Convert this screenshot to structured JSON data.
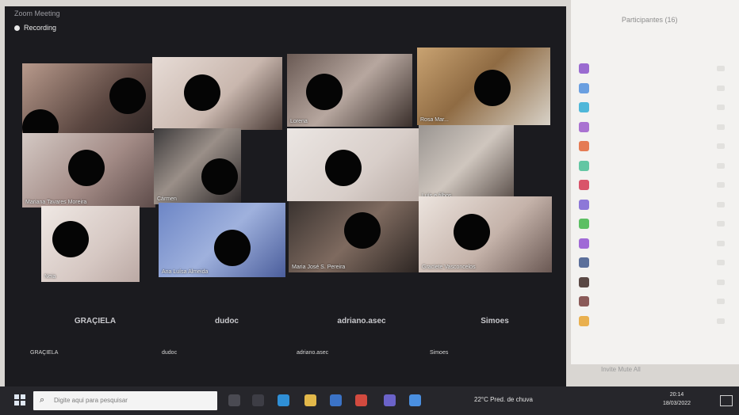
{
  "window": {
    "title": "Zoom Meeting",
    "recording_label": "Recording"
  },
  "video_tiles": [
    {
      "name": "",
      "bg": "linear-gradient(135deg,#b89a8c,#5a4640 60%,#2c2423)"
    },
    {
      "name": "",
      "bg": "linear-gradient(135deg,#e7dcd6,#c9b7ae 55%,#4a3b36)"
    },
    {
      "name": "Lorena",
      "bg": "linear-gradient(135deg,#6a5a54,#b7a79f 50%,#3a2f2b)"
    },
    {
      "name": "Rosa Mar...",
      "bg": "linear-gradient(135deg,#c9a372,#8f6b43 45%,#d8d2c8)"
    },
    {
      "name": "Mariana Tavares Moreira",
      "bg": "linear-gradient(135deg,#d4c9c4,#a38b86 55%,#5d4b49)"
    },
    {
      "name": "Cármen",
      "bg": "linear-gradient(135deg,#3c3a3b,#9a8f88 45%,#2a2627)"
    },
    {
      "name": "",
      "bg": "linear-gradient(135deg,#ebe6e3,#d8cec9 60%,#b9aca6)"
    },
    {
      "name": "Luís e filhos",
      "bg": "linear-gradient(135deg,#9a9591,#cfc6be 50%,#584d48)"
    },
    {
      "name": "Neia",
      "bg": "linear-gradient(135deg,#efe8e4,#d6c8c3 60%,#bba9a4)"
    },
    {
      "name": "Ana Luísa Almeida",
      "bg": "linear-gradient(135deg,#6d86c6,#9fb1dd 50%,#4b5e9c)"
    },
    {
      "name": "Maria José S. Pereira",
      "bg": "linear-gradient(135deg,#3a3330,#7e6a5f 50%,#2c2522)"
    },
    {
      "name": "Graciete Vasconcelos",
      "bg": "linear-gradient(135deg,#ece4de,#c5b3aa 55%,#6a5853)"
    }
  ],
  "audio_tiles": [
    {
      "display_name": "GRAÇIELA",
      "label": "GRAÇIELA"
    },
    {
      "display_name": "dudoc",
      "label": "dudoc"
    },
    {
      "display_name": "adriano.asec",
      "label": "adriano.asec"
    },
    {
      "display_name": "Simoes",
      "label": "Simoes"
    }
  ],
  "panel": {
    "title": "Participantes (16)",
    "participants": [
      {
        "color": "#9a6bd0",
        "name": ""
      },
      {
        "color": "#6a9fe0",
        "name": ""
      },
      {
        "color": "#4fb7d9",
        "name": ""
      },
      {
        "color": "#a972d1",
        "name": ""
      },
      {
        "color": "#e57b54",
        "name": ""
      },
      {
        "color": "#63c6a3",
        "name": ""
      },
      {
        "color": "#d9546a",
        "name": ""
      },
      {
        "color": "#8d78d8",
        "name": ""
      },
      {
        "color": "#5cbf63",
        "name": ""
      },
      {
        "color": "#a06ad6",
        "name": ""
      },
      {
        "color": "#5b6f9a",
        "name": ""
      },
      {
        "color": "#5a4844",
        "name": ""
      },
      {
        "color": "#8a5a58",
        "name": ""
      },
      {
        "color": "#e9b04f",
        "name": ""
      }
    ],
    "footer": "Invite                Mute All"
  },
  "taskbar": {
    "search_placeholder": "Digite aqui para pesquisar",
    "weather": "22°C  Pred. de chuva",
    "time": "20:14",
    "date": "18/03/2022",
    "app_icons": [
      {
        "name": "task-view-icon",
        "color": "#4a4a52"
      },
      {
        "name": "windows-tile-icon",
        "color": "#3d3d45"
      },
      {
        "name": "edge-icon",
        "color": "#2f8fd6"
      },
      {
        "name": "file-explorer-icon",
        "color": "#e2b84a"
      },
      {
        "name": "store-icon",
        "color": "#3b73c7"
      },
      {
        "name": "chrome-icon",
        "color": "#d24a3f"
      },
      {
        "name": "teams-icon",
        "color": "#6b63c9"
      },
      {
        "name": "zoom-icon",
        "color": "#4a8fe0"
      }
    ]
  }
}
